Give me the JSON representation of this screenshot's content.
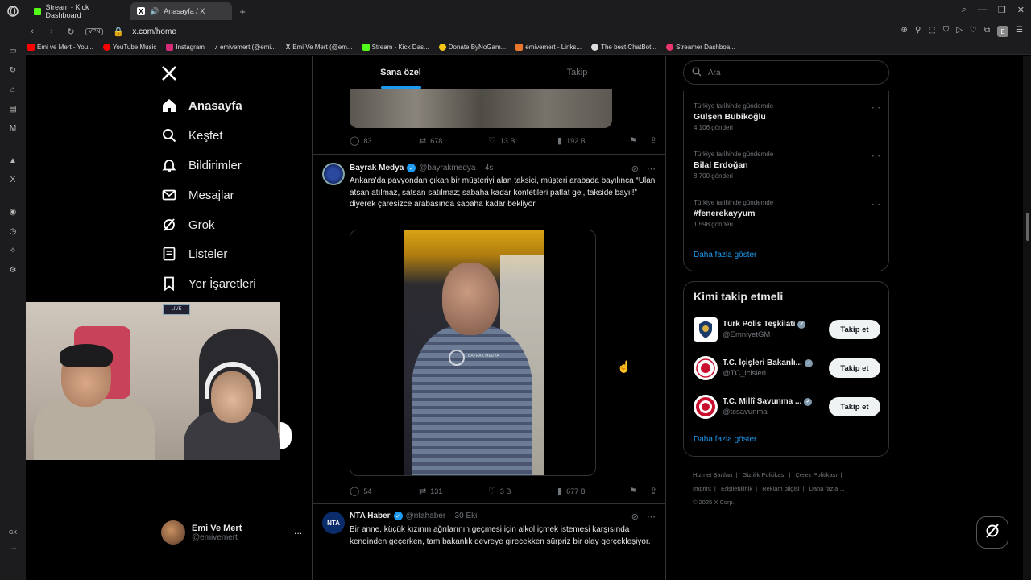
{
  "browser": {
    "tabs": [
      {
        "label": "Stream - Kick Dashboard",
        "active": false
      },
      {
        "label": "Anasayfa / X",
        "active": true
      }
    ],
    "url": "x.com/home",
    "vpn_label": "VPN",
    "profile_letter": "E",
    "bookmarks": [
      {
        "label": "Emi ve Mert - You...",
        "color": "#ff0000"
      },
      {
        "label": "YouTube Music",
        "color": "#ff0000"
      },
      {
        "label": "Instagram",
        "color": "#d62976"
      },
      {
        "label": "emivemert (@emi...",
        "color": "#ffffff"
      },
      {
        "label": "Emi Ve Mert (@em...",
        "color": "#ffffff"
      },
      {
        "label": "Stream - Kick Das...",
        "color": "#53fc18"
      },
      {
        "label": "Donate ByNoGam...",
        "color": "#f5c518"
      },
      {
        "label": "emivemert - Links...",
        "color": "#e8762c"
      },
      {
        "label": "The best ChatBot...",
        "color": "#dddddd"
      },
      {
        "label": "Streamer Dashboa...",
        "color": "#e9356c"
      }
    ],
    "dock_bottom_label": "GX"
  },
  "nav": {
    "items": [
      {
        "label": "Anasayfa",
        "icon": "home-icon"
      },
      {
        "label": "Keşfet",
        "icon": "search-icon"
      },
      {
        "label": "Bildirimler",
        "icon": "bell-icon"
      },
      {
        "label": "Mesajlar",
        "icon": "mail-icon"
      },
      {
        "label": "Grok",
        "icon": "grok-icon"
      },
      {
        "label": "Listeler",
        "icon": "list-icon"
      },
      {
        "label": "Yer İşaretleri",
        "icon": "bookmark-icon"
      }
    ],
    "profile": {
      "name": "Emi Ve Mert",
      "handle": "@emivemert",
      "more": "..."
    }
  },
  "timeline": {
    "tabs": [
      "Sana özel",
      "Takip"
    ],
    "prev_tweet_stats": {
      "replies": "83",
      "reposts": "678",
      "likes": "13 B",
      "views": "192 B"
    },
    "tweets": [
      {
        "name": "Bayrak Medya",
        "handle": "@bayrakmedya",
        "time": "4s",
        "text": "Ankara'da pavyondan çıkan bir müşteriyi alan taksici, müşteri arabada bayılınca “Ulan atsan atılmaz, satsan satılmaz; sabaha kadar konfetileri patlat gel, takside bayıl!” diyerek çaresizce arabasında sabaha kadar bekliyor.",
        "watermark": "BAYRAK MEDYA",
        "stats": {
          "replies": "54",
          "reposts": "131",
          "likes": "3 B",
          "views": "677 B"
        }
      },
      {
        "name": "NTA Haber",
        "handle": "@ntahaber",
        "time": "30 Eki",
        "avatar_text": "NTA",
        "text": "Bir anne, küçük kızının ağrılarının geçmesi için alkol içmek istemesi karşısında kendinden geçerken, tam bakanlık devreye girecekken sürpriz bir olay gerçekleşiyor."
      }
    ]
  },
  "right": {
    "search_placeholder": "Ara",
    "trends": [
      {
        "context": "Türkiye tarihinde gündemde",
        "title": "Gülşen Bubikoğlu",
        "count": "4.106 gönderi"
      },
      {
        "context": "Türkiye tarihinde gündemde",
        "title": "Bilal Erdoğan",
        "count": "8.700 gönderi"
      },
      {
        "context": "Türkiye tarihinde gündemde",
        "title": "#fenerekayyum",
        "count": "1.598 gönderi"
      }
    ],
    "trends_show_more": "Daha fazla göster",
    "who_to_follow_title": "Kimi takip etmeli",
    "who_to_follow": [
      {
        "name": "Türk Polis Teşkilatı",
        "handle": "@EmniyetGM",
        "button": "Takip et"
      },
      {
        "name": "T.C. İçişleri Bakanlı...",
        "handle": "@TC_icisleri",
        "button": "Takip et"
      },
      {
        "name": "T.C. Millî Savunma ...",
        "handle": "@tcsavunma",
        "button": "Takip et"
      }
    ],
    "follow_show_more": "Daha fazla göster",
    "footer": [
      "Hizmet Şartları",
      "Gizlilik Politikası",
      "Çerez Politikası",
      "Imprint",
      "Erişilebilirlik",
      "Reklam bilgisi",
      "Daha fazla ...",
      "© 2025 X Corp."
    ]
  },
  "webcam_badge": "LIVE",
  "colors": {
    "accent": "#1d9bf0",
    "background": "#000000",
    "border": "#2f3336",
    "muted": "#71767b"
  }
}
